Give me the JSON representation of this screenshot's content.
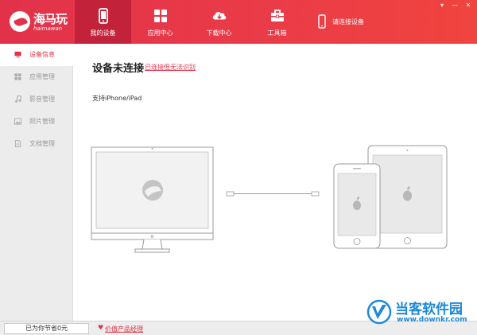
{
  "header": {
    "logo_cn": "海马玩",
    "logo_en": "haimawan",
    "tabs": [
      {
        "label": "我的设备",
        "icon": "phone-icon",
        "active": true
      },
      {
        "label": "应用中心",
        "icon": "apps-grid-icon",
        "active": false
      },
      {
        "label": "下载中心",
        "icon": "cloud-download-icon",
        "active": false
      },
      {
        "label": "工具箱",
        "icon": "toolbox-icon",
        "active": false
      }
    ],
    "connect_label": "请连接设备",
    "window_controls": [
      "▾",
      "—",
      "✕"
    ]
  },
  "sidebar": {
    "items": [
      {
        "label": "设备信息",
        "icon": "monitor-icon",
        "active": true
      },
      {
        "label": "应用管理",
        "icon": "apps-icon",
        "active": false
      },
      {
        "label": "影音管理",
        "icon": "music-note-icon",
        "active": false
      },
      {
        "label": "照片管理",
        "icon": "photo-icon",
        "active": false
      },
      {
        "label": "文档管理",
        "icon": "document-icon",
        "active": false
      }
    ]
  },
  "main": {
    "title": "设备未连接",
    "link": "已连接但无法识别",
    "support_text": "支持iPhone/iPad"
  },
  "footer": {
    "saved_text": "已为你节省0元",
    "promo_text": "价值产品经理"
  },
  "watermark": {
    "name": "当客软件园",
    "url": "www.downkr.com"
  },
  "colors": {
    "brand_red": "#e2324a",
    "active_tab": "#c2233a",
    "watermark_blue": "#1e88d8"
  }
}
